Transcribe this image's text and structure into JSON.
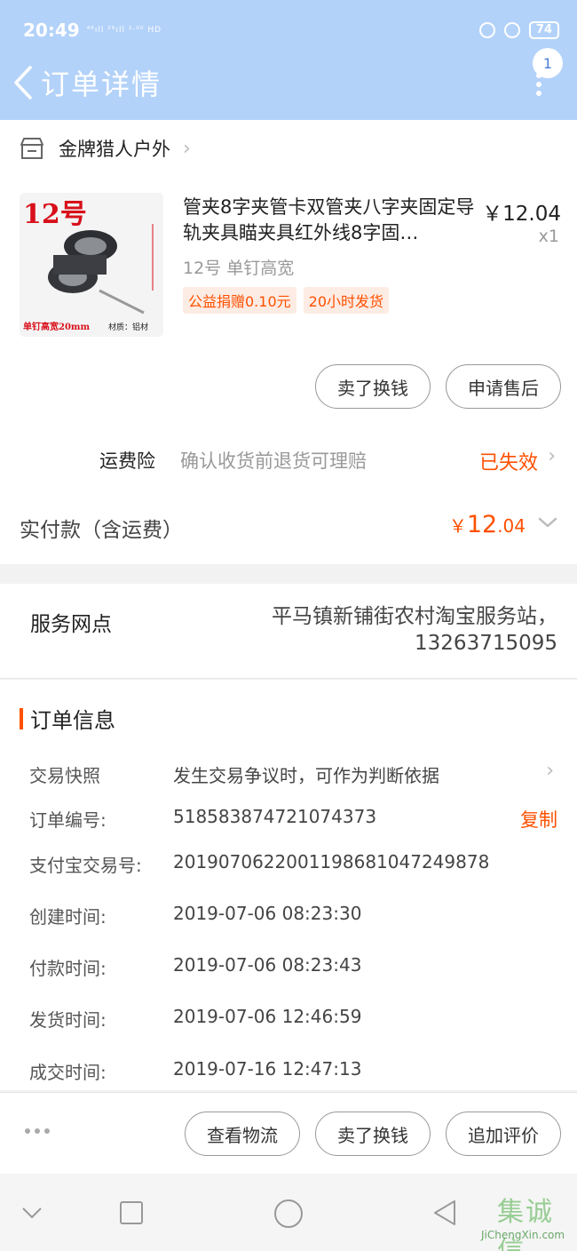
{
  "status_bar": {
    "time": "20:49",
    "signal_text": "⁴⁶ıll ²⁶ıll ²·⁰⁰ HD",
    "battery": "74"
  },
  "header": {
    "title": "订单详情",
    "notification_count": "1"
  },
  "shop": {
    "name": "金牌猎人户外"
  },
  "product": {
    "image_label_size": "12号",
    "image_caption_left": "单钉高宽20mm",
    "image_caption_right": "材质：铝材",
    "title": "管夹8字夹管卡双管夹八字夹固定导轨夹具瞄夹具红外线8字固…",
    "price": "￥12.04",
    "quantity": "x1",
    "sku": "12号 单钉高宽",
    "tags": [
      "公益捐赠0.10元",
      "20小时发货"
    ]
  },
  "item_actions": {
    "sell_label": "卖了换钱",
    "after_sale_label": "申请售后"
  },
  "insurance": {
    "label": "运费险",
    "description": "确认收货前退货可理赔",
    "status": "已失效"
  },
  "payment": {
    "label": "实付款（含运费）",
    "currency": "￥",
    "amount_int": "12",
    "amount_dec": ".04"
  },
  "service": {
    "label": "服务网点",
    "value_line1": "平马镇新铺街农村淘宝服务站，",
    "value_line2": "13263715095"
  },
  "order_info": {
    "title": "订单信息",
    "rows": [
      {
        "key": "交易快照",
        "value": "发生交易争议时，可作为判断依据"
      },
      {
        "key": "订单编号:",
        "value": "518583874721074373",
        "action": "复制"
      },
      {
        "key": "支付宝交易号:",
        "value": "2019070622001198681047249878"
      },
      {
        "key": "创建时间:",
        "value": "2019-07-06 08:23:30"
      },
      {
        "key": "付款时间:",
        "value": "2019-07-06 08:23:43"
      },
      {
        "key": "发货时间:",
        "value": "2019-07-06 12:46:59"
      },
      {
        "key": "成交时间:",
        "value": "2019-07-16 12:47:13"
      }
    ]
  },
  "bottom_actions": {
    "logistics_label": "查看物流",
    "sell_label": "卖了换钱",
    "review_label": "追加评价"
  },
  "watermark": {
    "main": "集诚信",
    "sub": "JiChengXin.com"
  },
  "colors": {
    "header_bg": "#b3d2f9",
    "accent": "#ff5000"
  }
}
